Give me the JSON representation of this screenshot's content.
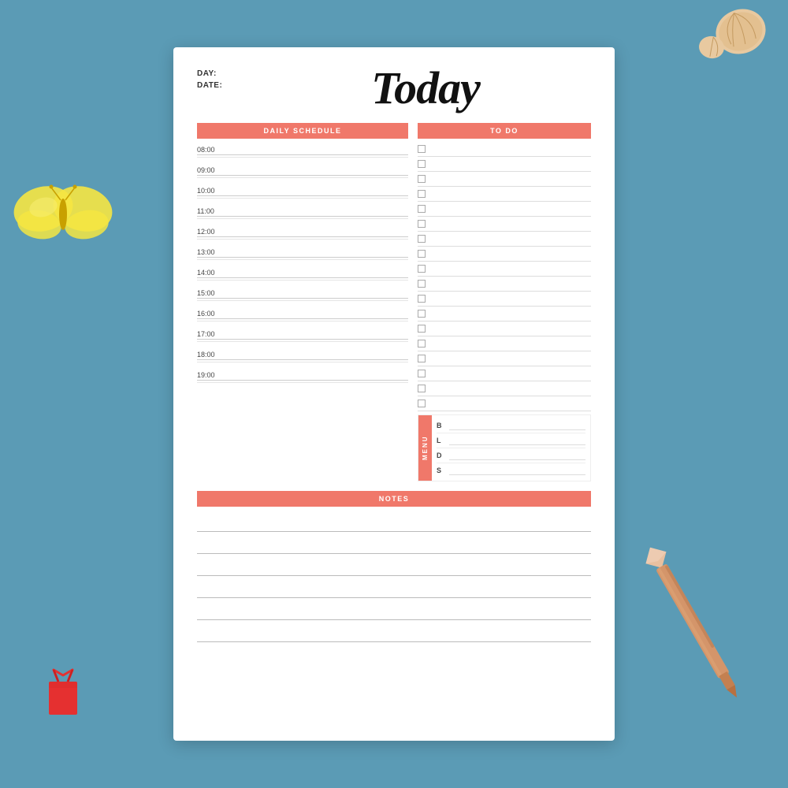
{
  "page": {
    "background_color": "#5b9bb5",
    "title": "Today",
    "day_label": "DAY:",
    "date_label": "DATE:",
    "accent_color": "#f0786a"
  },
  "daily_schedule": {
    "header": "DAILY SCHEDULE",
    "times": [
      "08:00",
      "09:00",
      "10:00",
      "11:00",
      "12:00",
      "13:00",
      "14:00",
      "15:00",
      "16:00",
      "17:00",
      "18:00",
      "19:00"
    ]
  },
  "todo": {
    "header": "TO DO",
    "items_count": 18
  },
  "menu": {
    "label": "MENU",
    "items": [
      {
        "key": "B",
        "label": "B"
      },
      {
        "key": "L",
        "label": "L"
      },
      {
        "key": "D",
        "label": "D"
      },
      {
        "key": "S",
        "label": "S"
      }
    ]
  },
  "notes": {
    "header": "NOTES",
    "lines_count": 6
  }
}
